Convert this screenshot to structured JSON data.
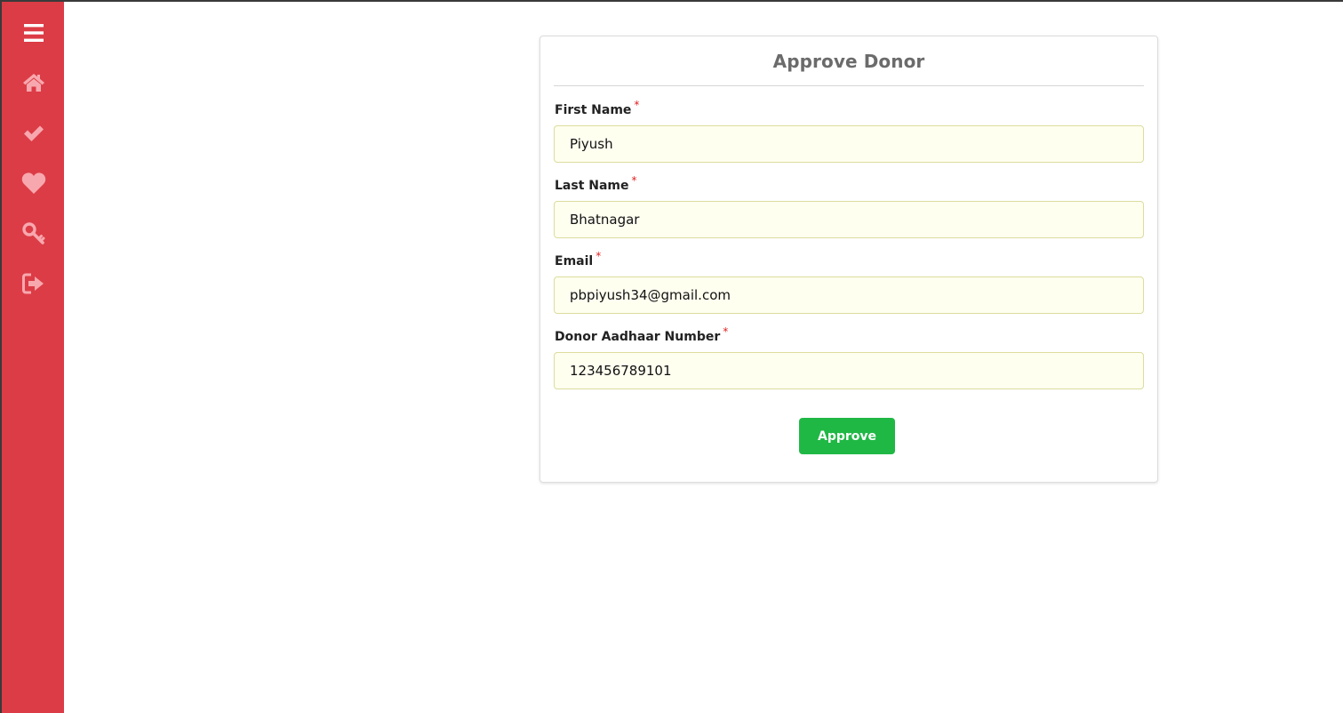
{
  "sidebar": {
    "background": "#dc3c46",
    "icon_color": "#f7a8ae",
    "items": [
      {
        "icon": "menu-icon"
      },
      {
        "icon": "home-icon"
      },
      {
        "icon": "check-icon"
      },
      {
        "icon": "heart-icon"
      },
      {
        "icon": "key-icon"
      },
      {
        "icon": "logout-icon"
      }
    ]
  },
  "form": {
    "title": "Approve Donor",
    "required_marker": "*",
    "fields": [
      {
        "label": "First Name",
        "value": "Piyush"
      },
      {
        "label": "Last Name",
        "value": "Bhatnagar"
      },
      {
        "label": "Email",
        "value": "pbpiyush34@gmail.com"
      },
      {
        "label": "Donor Aadhaar Number",
        "value": "123456789101"
      }
    ],
    "submit_label": "Approve",
    "submit_color": "#20b845",
    "input_background": "#fffff0"
  }
}
